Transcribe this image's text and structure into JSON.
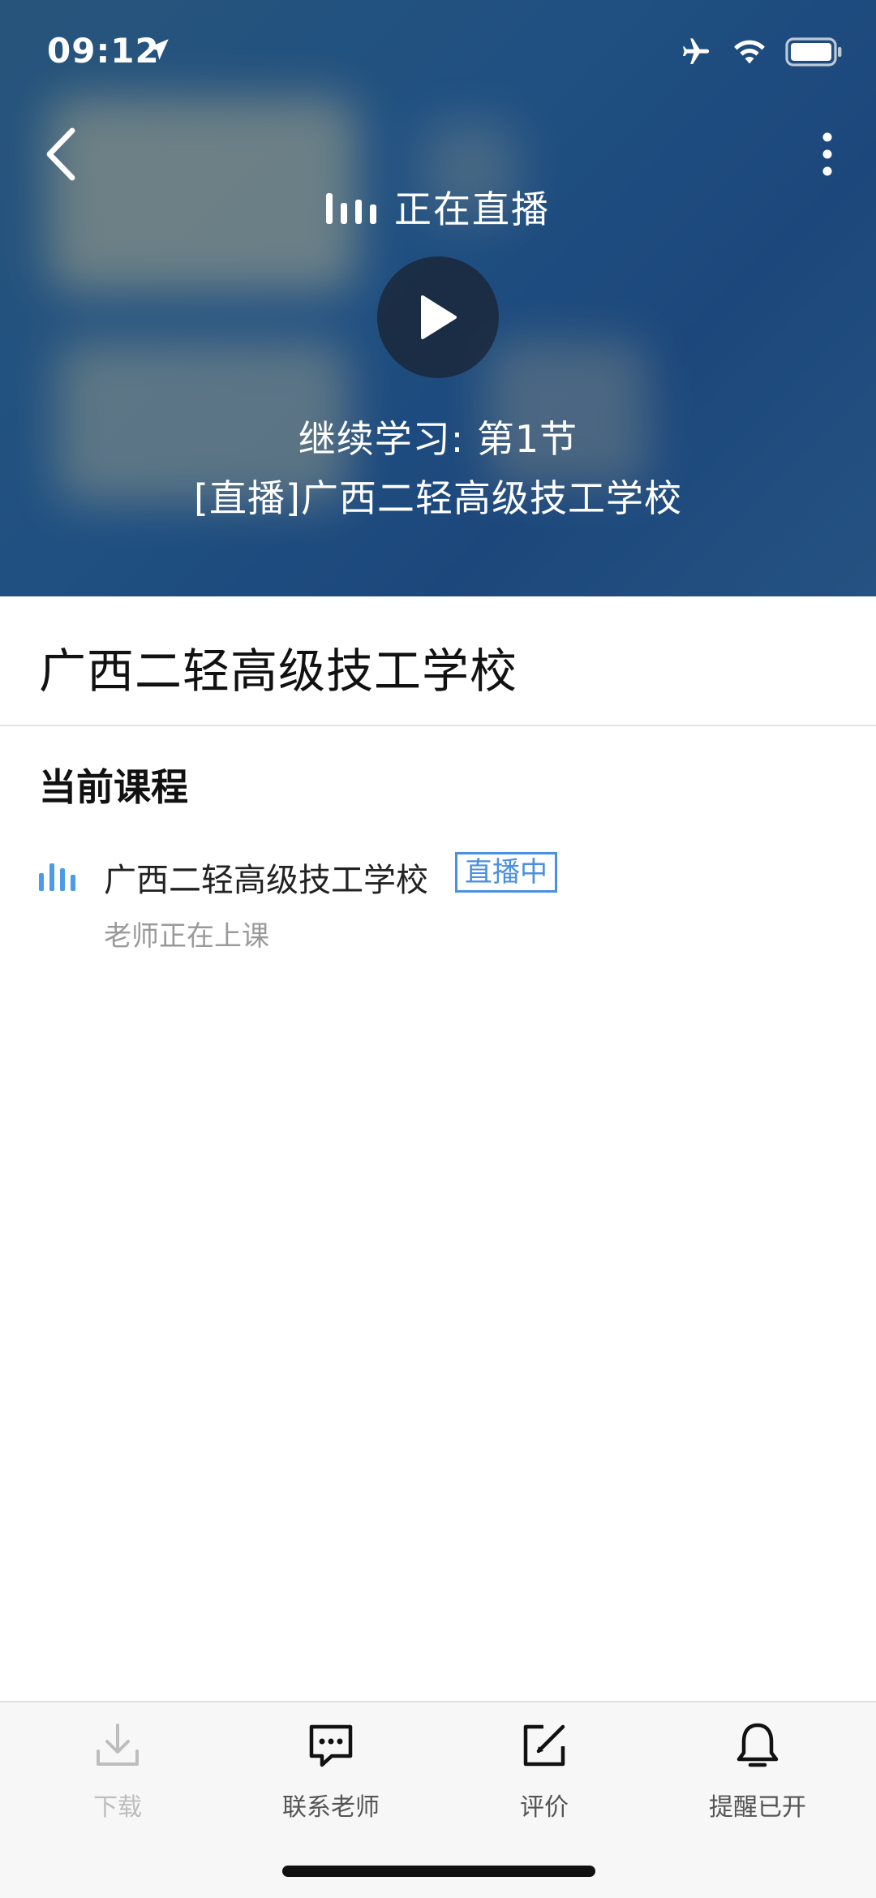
{
  "status_bar": {
    "time": "09:12",
    "icons": [
      "location-arrow-icon",
      "airplane-icon",
      "wifi-icon",
      "battery-icon"
    ]
  },
  "player": {
    "live_status": "正在直播",
    "continue_label": "继续学习: 第1节",
    "lesson_title": "[直播]广西二轻高级技工学校"
  },
  "course": {
    "title": "广西二轻高级技工学校"
  },
  "current_section": {
    "heading": "当前课程",
    "item": {
      "name": "广西二轻高级技工学校",
      "badge": "直播中",
      "subtitle": "老师正在上课"
    }
  },
  "toolbar": {
    "items": [
      {
        "label": "下载",
        "icon": "download-icon",
        "enabled": false
      },
      {
        "label": "联系老师",
        "icon": "chat-icon",
        "enabled": true
      },
      {
        "label": "评价",
        "icon": "edit-icon",
        "enabled": true
      },
      {
        "label": "提醒已开",
        "icon": "bell-icon",
        "enabled": true
      }
    ]
  },
  "colors": {
    "accent": "#4a90e2",
    "hero": "#245a8f",
    "muted_text": "#9a9a9a"
  }
}
